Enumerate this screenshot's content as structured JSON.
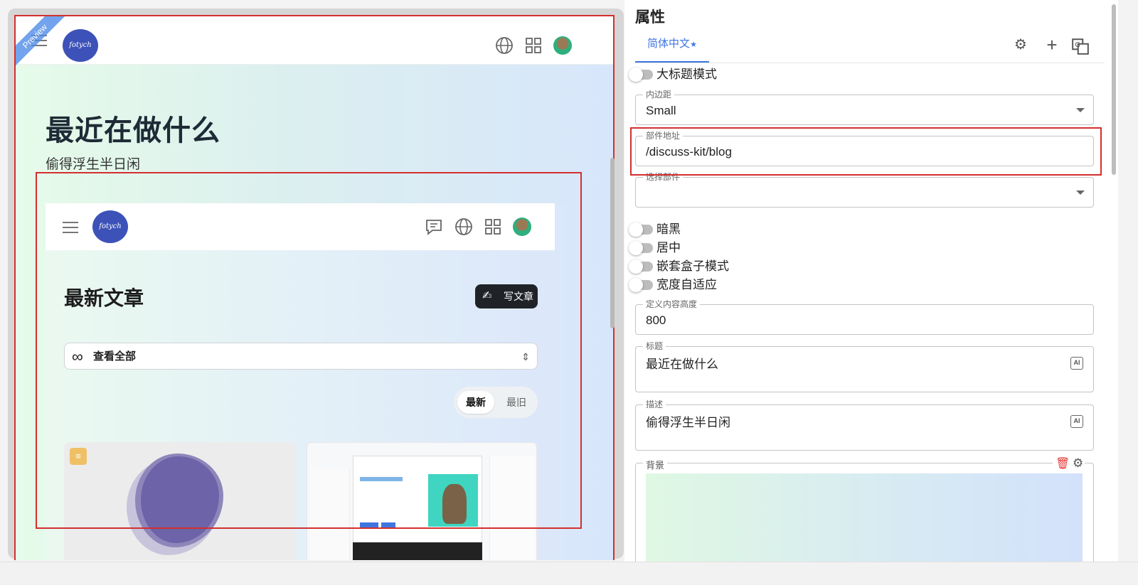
{
  "preview": {
    "ribbon": "Preview",
    "logo_text": "fotych",
    "hero_title": "最近在做什么",
    "hero_desc": "偷得浮生半日闲",
    "nested": {
      "logo_text": "fotych",
      "title": "最新文章",
      "write_button": "写文章",
      "view_all": "查看全部",
      "sort": {
        "newest": "最新",
        "oldest": "最旧"
      }
    }
  },
  "panel": {
    "title": "属性",
    "tab_label": "简体中文",
    "tab_marker": "★",
    "switches": {
      "big_title": "大标题模式",
      "dark": "暗黑",
      "center": "居中",
      "nested_box": "嵌套盒子模式",
      "auto_width": "宽度自适应"
    },
    "fields": {
      "padding": {
        "label": "内边距",
        "value": "Small"
      },
      "component_url": {
        "label": "部件地址",
        "value": "/discuss-kit/blog"
      },
      "select_component": {
        "label": "选择部件",
        "value": ""
      },
      "content_height": {
        "label": "定义内容高度",
        "value": "800"
      },
      "title": {
        "label": "标题",
        "value": "最近在做什么"
      },
      "description": {
        "label": "描述",
        "value": "偷得浮生半日闲"
      },
      "background": {
        "label": "背景"
      }
    },
    "ai_badge": "AI"
  },
  "colors": {
    "accent": "#3f76e0",
    "highlight_border": "#d32f2f",
    "logo": "#3d52b8"
  }
}
